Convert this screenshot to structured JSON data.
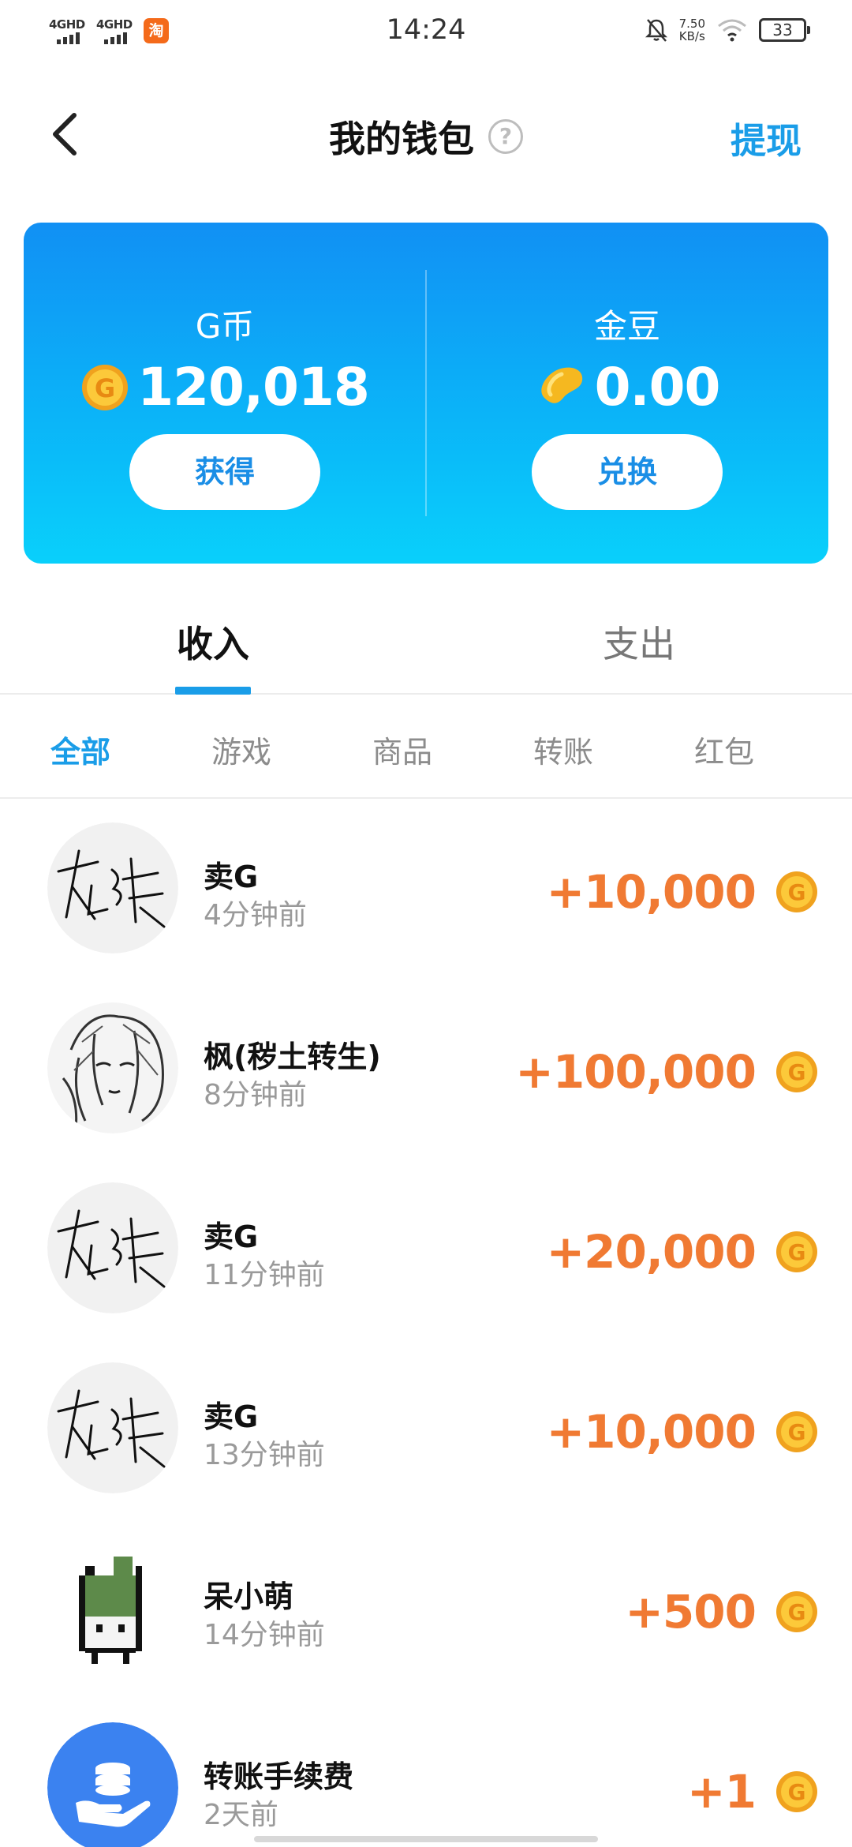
{
  "status_bar": {
    "sim1": "4GHD",
    "sim2": "4GHD",
    "taobao_icon": "淘",
    "time": "14:24",
    "speed_value": "7.50",
    "speed_unit": "KB/s",
    "battery": "33"
  },
  "header": {
    "title": "我的钱包",
    "help_icon": "?",
    "withdraw_label": "提现"
  },
  "balance": {
    "g_coin": {
      "label": "G币",
      "amount": "120,018",
      "button": "获得"
    },
    "gold_bean": {
      "label": "金豆",
      "amount": "0.00",
      "button": "兑换"
    }
  },
  "main_tabs": [
    {
      "label": "收入",
      "active": true
    },
    {
      "label": "支出",
      "active": false
    }
  ],
  "filter_tabs": [
    {
      "label": "全部",
      "active": true
    },
    {
      "label": "游戏",
      "active": false
    },
    {
      "label": "商品",
      "active": false
    },
    {
      "label": "转账",
      "active": false
    },
    {
      "label": "红包",
      "active": false
    }
  ],
  "transactions": [
    {
      "title": "卖G",
      "time": "4分钟前",
      "amount": "+10,000",
      "avatar": "handwriting-avatar"
    },
    {
      "title": "枫(秽土转生)",
      "time": "8分钟前",
      "amount": "+100,000",
      "avatar": "anime-sketch-avatar"
    },
    {
      "title": "卖G",
      "time": "11分钟前",
      "amount": "+20,000",
      "avatar": "handwriting-avatar"
    },
    {
      "title": "卖G",
      "time": "13分钟前",
      "amount": "+10,000",
      "avatar": "handwriting-avatar"
    },
    {
      "title": "呆小萌",
      "time": "14分钟前",
      "amount": "+500",
      "avatar": "pixel-character-avatar"
    },
    {
      "title": "转账手续费",
      "time": "2天前",
      "amount": "+1",
      "avatar": "coin-hand-avatar"
    }
  ],
  "colors": {
    "accent_blue": "#1a9de8",
    "amount_orange": "#f07a33",
    "card_top": "#1190f4",
    "card_bottom": "#09d0fb"
  }
}
